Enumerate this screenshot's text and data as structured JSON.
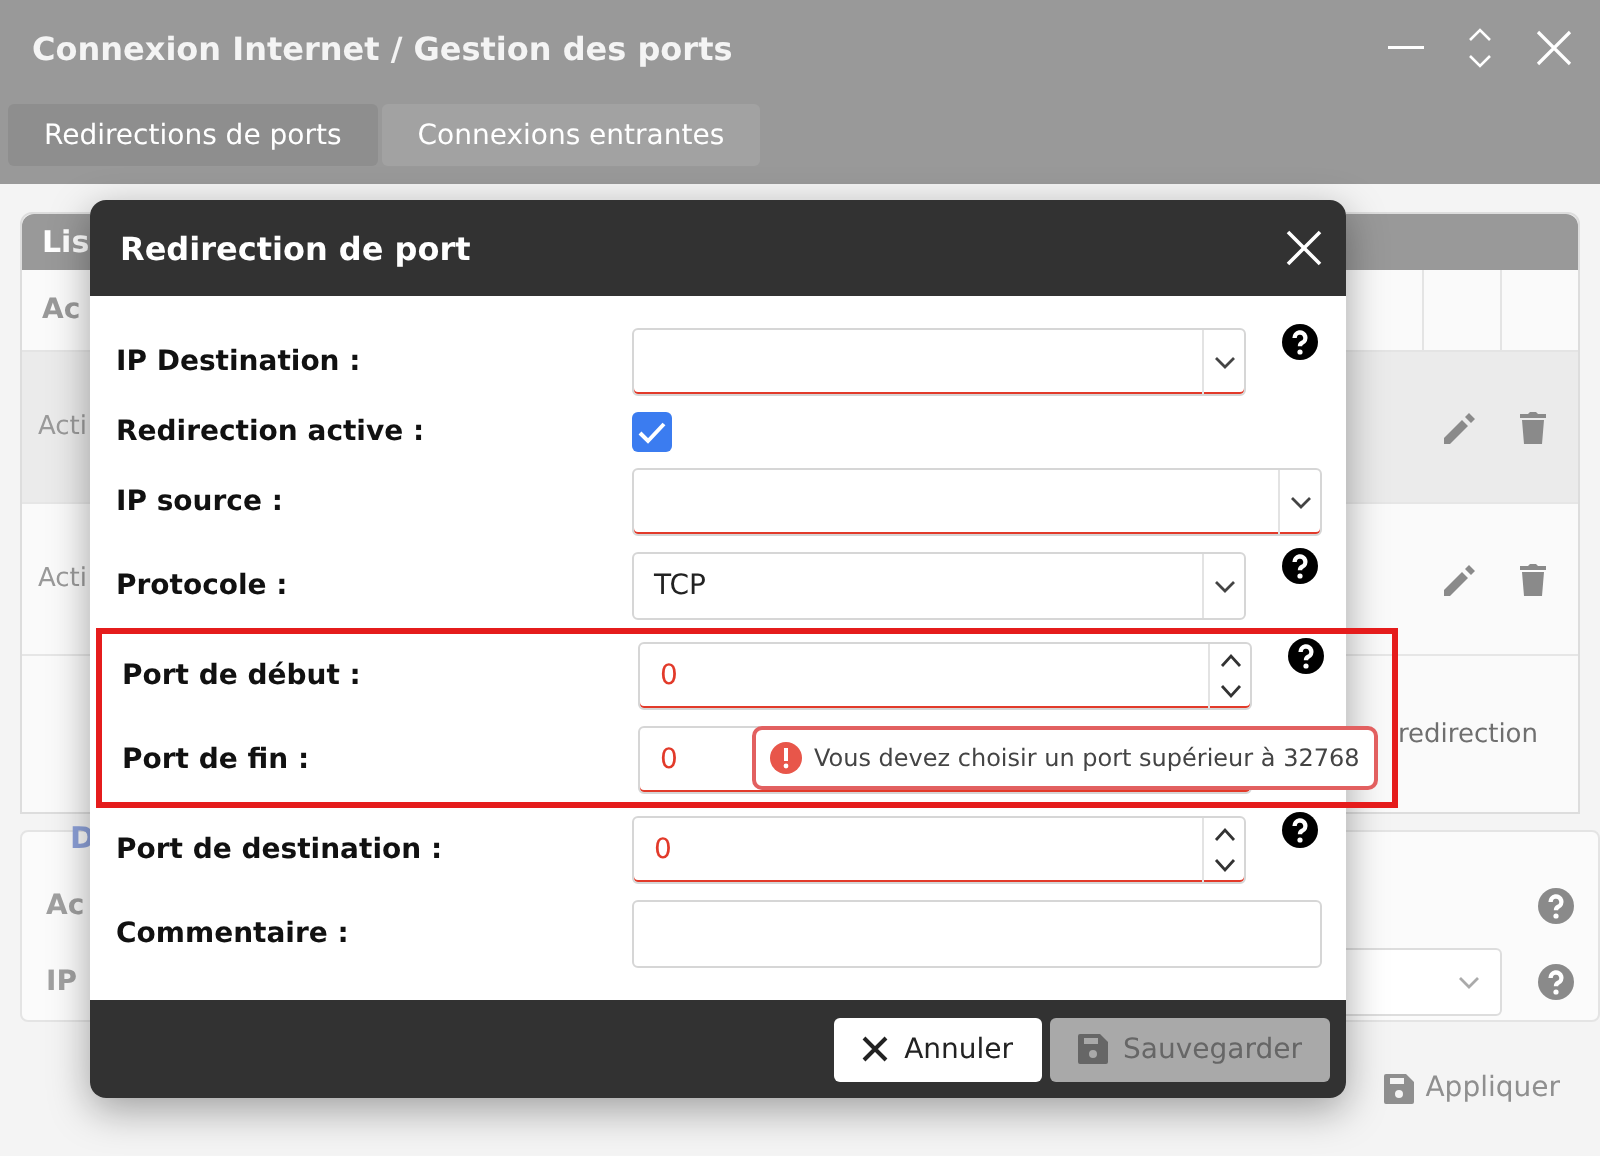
{
  "window": {
    "title": "Connexion Internet / Gestion des ports"
  },
  "tabs": [
    {
      "label": "Redirections de ports",
      "selected": true
    },
    {
      "label": "Connexions entrantes",
      "selected": false
    }
  ],
  "background": {
    "panel_title": "Lis",
    "column_1": "Ac",
    "rows": [
      {
        "status": "Acti",
        "selected": true
      },
      {
        "status": "Acti",
        "selected": false
      }
    ],
    "add_link": "redirection",
    "section_title": "D",
    "section_fields": [
      {
        "label": "Ac",
        "kind": "text"
      },
      {
        "label": "IP",
        "kind": "select"
      }
    ],
    "apply_button": {
      "label": "Appliquer",
      "disabled": true
    }
  },
  "dialog": {
    "title": "Redirection de port",
    "fields": [
      {
        "label": "IP Destination :",
        "kind": "select",
        "invalid": true,
        "help": true,
        "highlighted": false
      },
      {
        "label": "Redirection active :",
        "kind": "checkbox",
        "checked": true,
        "help": false,
        "highlighted": false
      },
      {
        "label": "IP source :",
        "kind": "select",
        "wide": true,
        "invalid": true,
        "help": false,
        "highlighted": false
      },
      {
        "label": "Protocole :",
        "kind": "select",
        "value": "TCP",
        "invalid": false,
        "help": true,
        "highlighted": false
      },
      {
        "label": "Port de début :",
        "kind": "number",
        "value": "0",
        "invalid": true,
        "help": true,
        "highlighted": true
      },
      {
        "label": "Port de fin :",
        "kind": "number",
        "value": "0",
        "invalid": true,
        "help": false,
        "highlighted": true,
        "error": "Vous devez choisir un port supérieur à 32768"
      },
      {
        "label": "Port de destination :",
        "kind": "number",
        "value": "0",
        "invalid": true,
        "help": true,
        "highlighted": false
      },
      {
        "label": "Commentaire :",
        "kind": "text",
        "wide": true,
        "invalid": false,
        "help": false,
        "highlighted": false
      }
    ],
    "buttons": [
      {
        "label": "Annuler",
        "kind": "cancel",
        "disabled": false
      },
      {
        "label": "Sauvegarder",
        "kind": "save",
        "disabled": true
      }
    ]
  }
}
